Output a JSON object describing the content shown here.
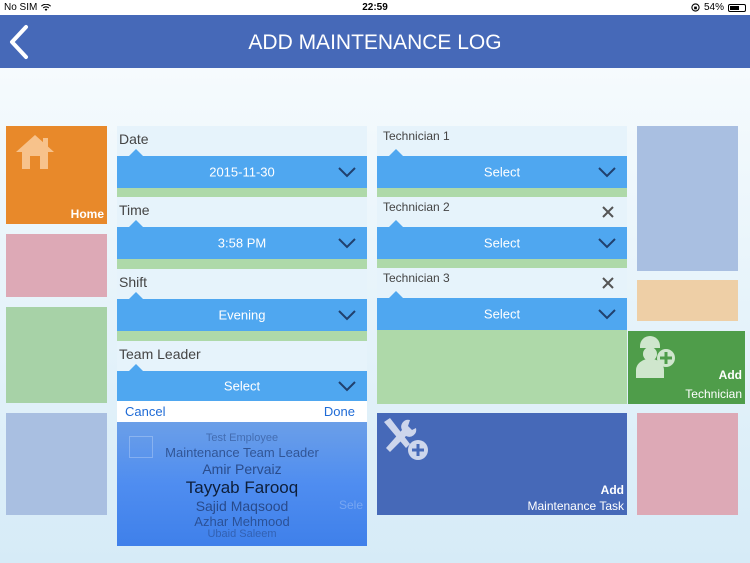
{
  "status": {
    "carrier": "No SIM",
    "time": "22:59",
    "battery": "54%"
  },
  "nav": {
    "title": "ADD MAINTENANCE LOG"
  },
  "tiles": {
    "home_label": "Home"
  },
  "form": {
    "date": {
      "label": "Date",
      "value": "2015-11-30"
    },
    "time": {
      "label": "Time",
      "value": "3:58 PM"
    },
    "shift": {
      "label": "Shift",
      "value": "Evening"
    },
    "team_leader": {
      "label": "Team Leader",
      "value": "Select"
    },
    "technician1": {
      "label": "Technician 1",
      "value": "Select"
    },
    "technician2": {
      "label": "Technician 2",
      "value": "Select"
    },
    "technician3": {
      "label": "Technician 3",
      "value": "Select"
    }
  },
  "picker": {
    "cancel": "Cancel",
    "done": "Done",
    "options": [
      "Test Employee",
      "Maintenance Team Leader",
      "Amir Pervaiz",
      "Tayyab Farooq",
      "Sajid Maqsood",
      "Azhar Mehmood",
      "Ubaid Saleem"
    ],
    "selected": "Tayyab Farooq",
    "ghost_text": "Sele"
  },
  "actions": {
    "add_technician": {
      "title": "Add",
      "subtitle": "Technician"
    },
    "add_task": {
      "title": "Add",
      "subtitle": "Maintenance Task"
    }
  },
  "colors": {
    "nav": "#4669b8",
    "select": "#4fa7f0",
    "home_tile": "#e8892a",
    "add_technician_tile": "#4f9d4a",
    "add_task_tile": "#4669b8"
  }
}
